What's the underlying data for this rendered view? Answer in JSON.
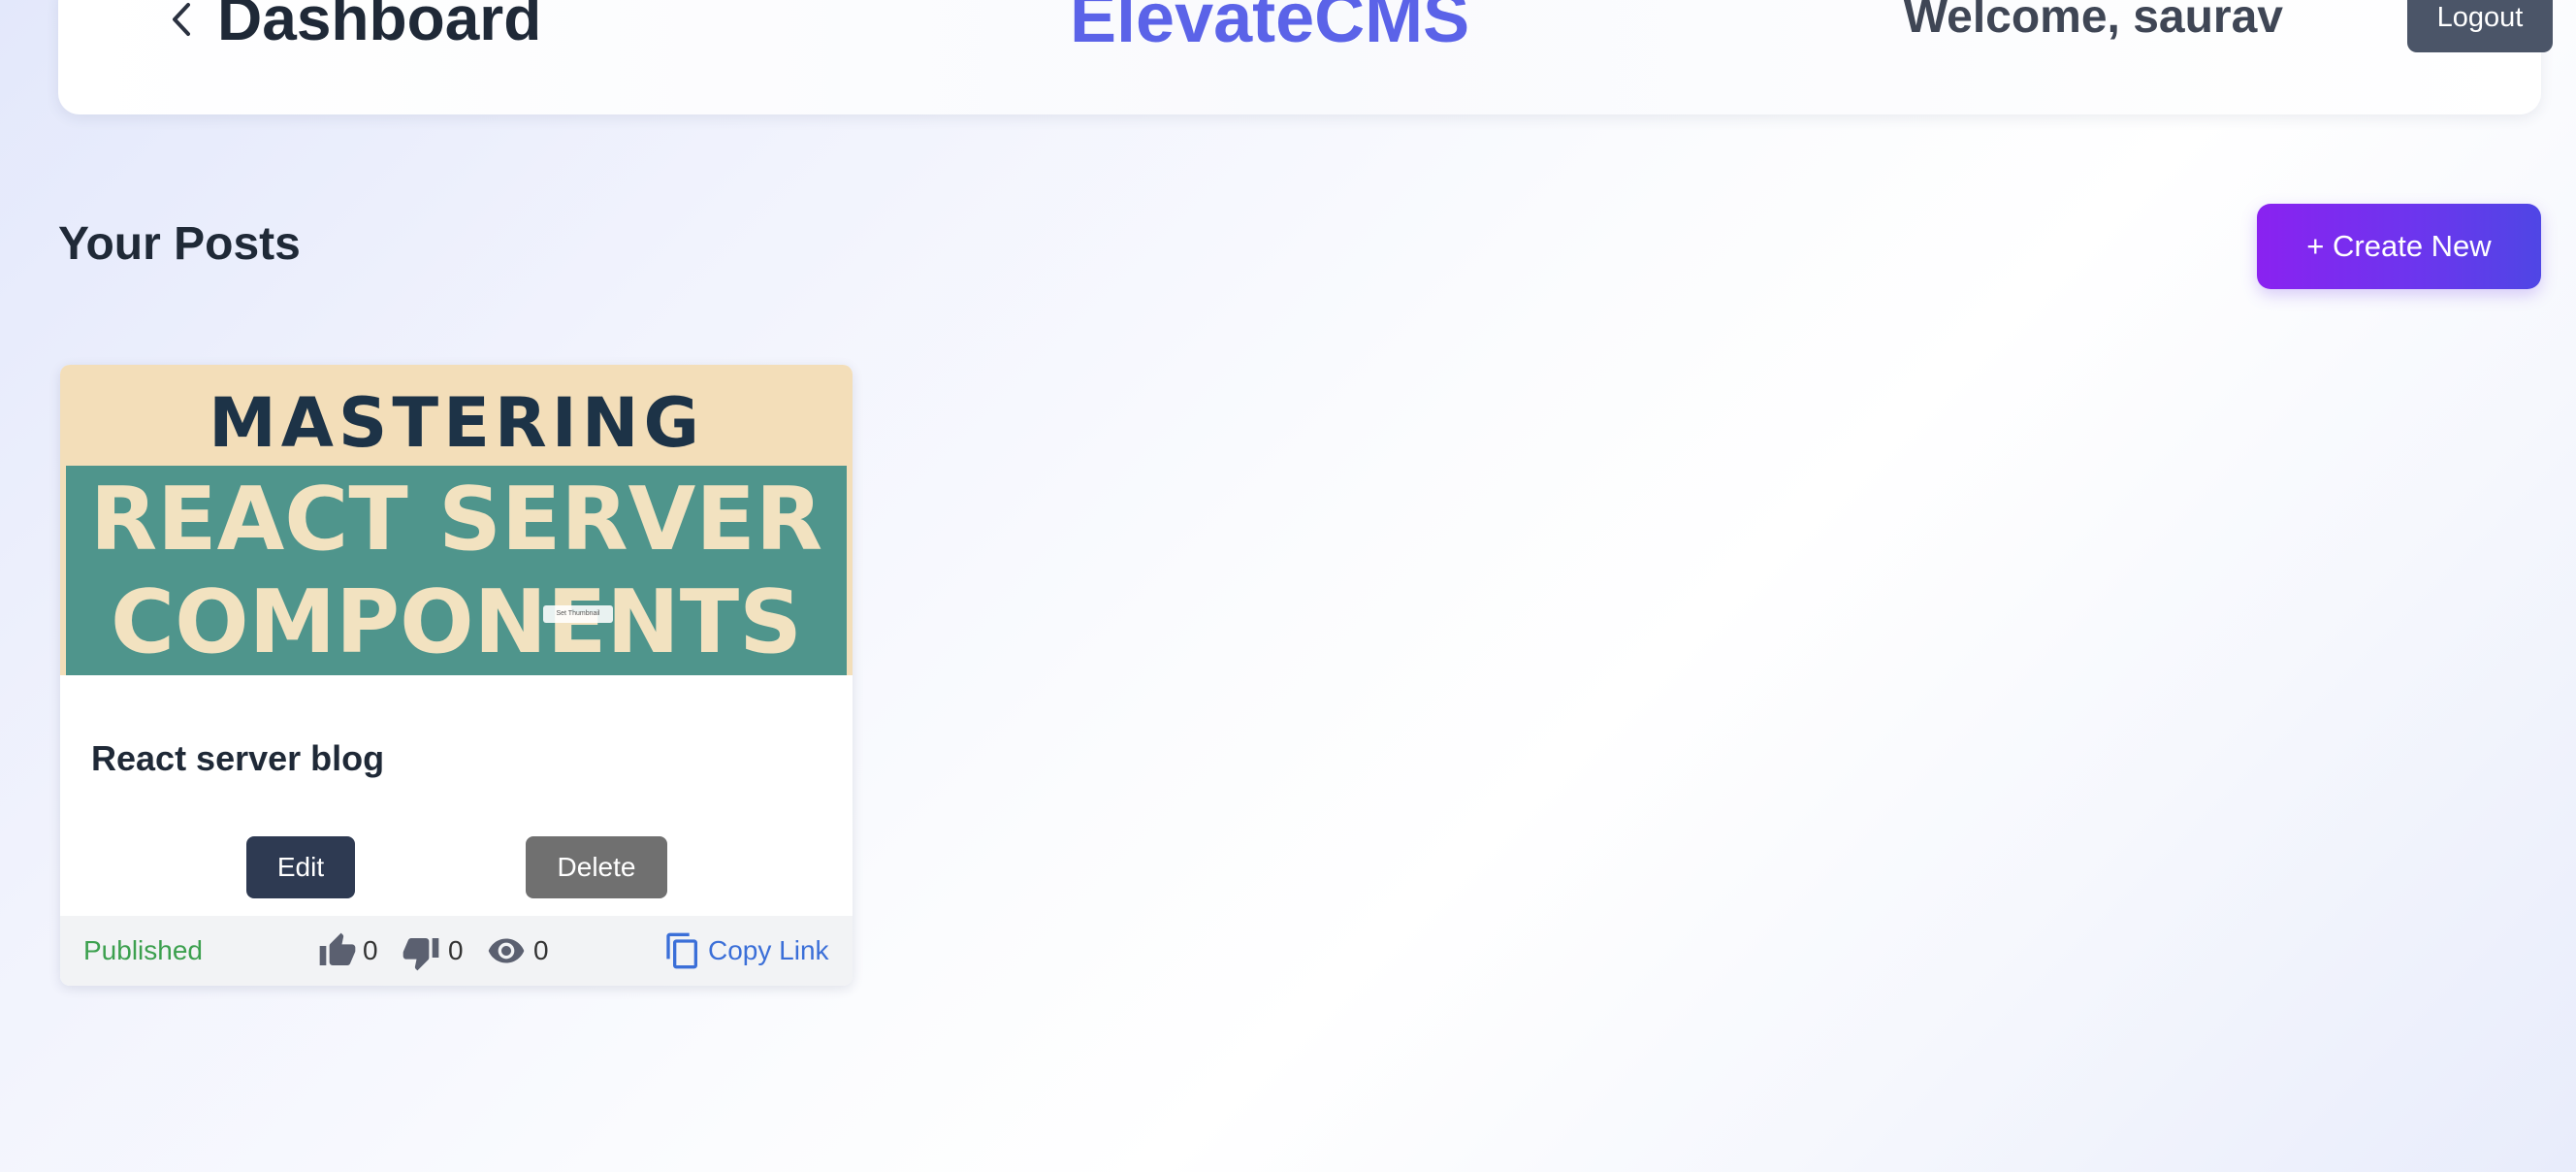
{
  "header": {
    "page_title": "Dashboard",
    "brand": "ElevateCMS",
    "welcome": "Welcome, saurav",
    "logout_label": "Logout"
  },
  "section": {
    "title": "Your Posts",
    "create_label": "+ Create New"
  },
  "posts": [
    {
      "thumbnail": {
        "line1": "MASTERING",
        "line2": "REACT SERVER",
        "line3": "COMPONENTS",
        "chip_label": "Set Thumbnail"
      },
      "title": "React server blog",
      "edit_label": "Edit",
      "delete_label": "Delete",
      "status": "Published",
      "likes": "0",
      "dislikes": "0",
      "views": "0",
      "copy_label": "Copy Link"
    }
  ],
  "colors": {
    "brand": "#5b63e8",
    "published": "#3ca04e",
    "link": "#3b6fd8",
    "create_gradient_start": "#8a22f0",
    "create_gradient_end": "#4f46e5",
    "edit_button": "#2e3a52",
    "delete_button": "#707070",
    "logout_button": "#4b5568"
  },
  "icons": {
    "back": "chevron-left-icon",
    "like": "thumb-up-icon",
    "dislike": "thumb-down-icon",
    "views": "eye-icon",
    "copy": "copy-icon"
  }
}
